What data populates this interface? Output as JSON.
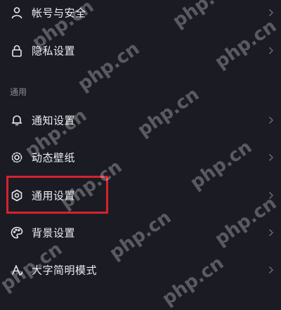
{
  "settings": {
    "items": [
      {
        "label": "帐号与安全",
        "icon": "person-icon"
      },
      {
        "label": "隐私设置",
        "icon": "lock-icon"
      },
      {
        "label": "通知设置",
        "icon": "bell-icon"
      },
      {
        "label": "动态壁纸",
        "icon": "wallpaper-icon"
      },
      {
        "label": "通用设置",
        "icon": "gear-icon"
      },
      {
        "label": "背景设置",
        "icon": "palette-icon"
      },
      {
        "label": "大字简明模式",
        "icon": "font-size-icon"
      }
    ],
    "section_general": "通用"
  },
  "watermark": "php.cn",
  "colors": {
    "background": "#1b1b24",
    "highlight": "#d6222e"
  }
}
